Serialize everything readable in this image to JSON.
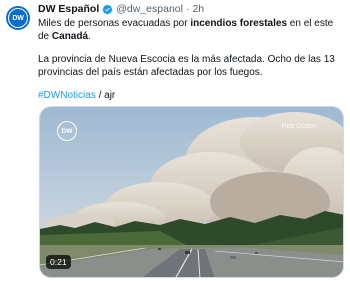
{
  "author": {
    "name": "DW Español",
    "handle": "@dw_espanol",
    "separator": "·",
    "time": "2h",
    "avatar_text": "DW"
  },
  "tweet": {
    "line1_prefix": "Miles de personas evacuadas por ",
    "line1_bold": "incendios forestales",
    "line1_mid": " en el este de ",
    "line1_bold2": "Canadá",
    "line1_suffix": ".",
    "para2": "La provincia de Nueva Escocia es la más afectada. Ocho de las 13 provincias del país están afectadas por los fuegos.",
    "hashtag": "#DWNoticias",
    "signature": " / ajr"
  },
  "media": {
    "logo_text": "DW",
    "credit": "Reb Dotton",
    "duration": "0:21",
    "verified_color": "#1d9bf0",
    "brand_color": "#0a6dcf"
  }
}
